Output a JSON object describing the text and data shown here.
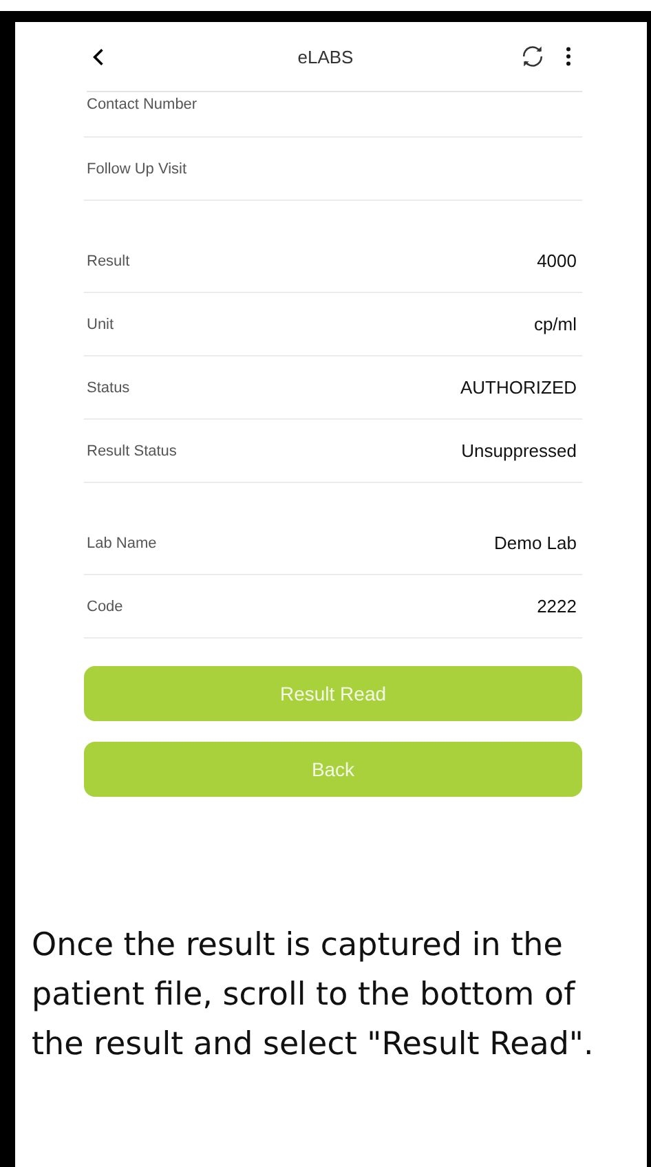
{
  "header": {
    "title": "eLABS"
  },
  "sections": [
    {
      "rows": [
        {
          "label": "Contact Number"
        },
        {
          "label": "Follow Up Visit"
        }
      ]
    },
    {
      "rows": [
        {
          "label": "Result",
          "value": "4000"
        },
        {
          "label": "Unit",
          "value": "cp/ml"
        },
        {
          "label": "Status",
          "value": "AUTHORIZED"
        },
        {
          "label": "Result Status",
          "value": "Unsuppressed"
        }
      ]
    },
    {
      "rows": [
        {
          "label": "Lab Name",
          "value": "Demo Lab"
        },
        {
          "label": "Code",
          "value": "2222"
        }
      ]
    }
  ],
  "buttons": [
    "Result Read",
    "Back"
  ],
  "caption": "Once the result is captured in the patient file, scroll to the bottom of the result and select \"Result Read\"."
}
